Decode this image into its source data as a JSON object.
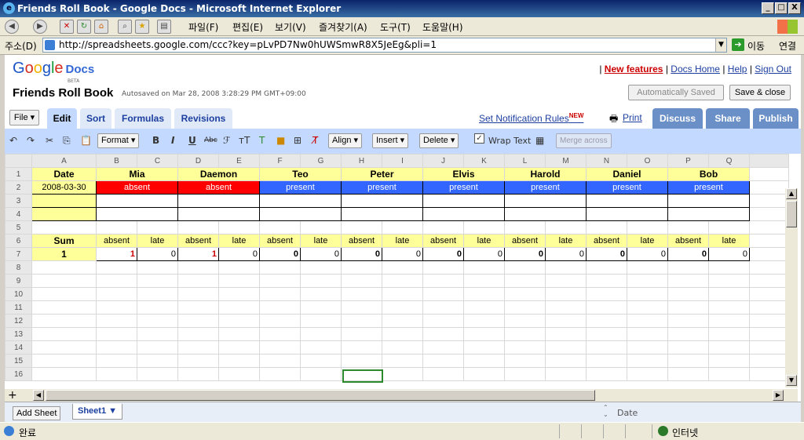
{
  "window": {
    "title": "Friends Roll Book - Google Docs - Microsoft Internet Explorer",
    "min": "_",
    "max": "□",
    "close": "X"
  },
  "menu": {
    "items": [
      "파일(F)",
      "편집(E)",
      "보기(V)",
      "즐겨찾기(A)",
      "도구(T)",
      "도움말(H)"
    ]
  },
  "address": {
    "label": "주소(D)",
    "url": "http://spreadsheets.google.com/ccc?key=pLvPD7Nw0hUWSmwR8X5JeEg&pli=1",
    "go": "이동",
    "links": "연결"
  },
  "header": {
    "logo_google": "Google",
    "logo_docs": "Docs",
    "beta": "BETA",
    "new_features": "New features",
    "docs_home": "Docs Home",
    "help": "Help",
    "sign_out": "Sign Out",
    "sep": "|",
    "title": "Friends Roll Book",
    "autosave": "Autosaved on Mar 28, 2008 3:28:29 PM GMT+09:00",
    "auto_saved_btn": "Automatically Saved",
    "save_close_btn": "Save & close"
  },
  "tabs": {
    "file": "File ▾",
    "edit": "Edit",
    "sort": "Sort",
    "formulas": "Formulas",
    "revisions": "Revisions",
    "notif": "Set Notification Rules",
    "notif_new": "NEW",
    "print": "Print",
    "discuss": "Discuss",
    "share": "Share",
    "publish": "Publish"
  },
  "toolbar": {
    "format": "Format ▾",
    "bold": "B",
    "italic": "I",
    "underline": "U",
    "strike": "Abc",
    "align": "Align ▾",
    "insert": "Insert ▾",
    "delete": "Delete ▾",
    "wrap": "Wrap Text",
    "merge": "Merge across"
  },
  "grid": {
    "cols": [
      "A",
      "B",
      "C",
      "D",
      "E",
      "F",
      "G",
      "H",
      "I",
      "J",
      "K",
      "L",
      "M",
      "N",
      "O",
      "P",
      "Q"
    ],
    "row1": [
      "Date",
      "Mia",
      "Daemon",
      "Teo",
      "Peter",
      "Elvis",
      "Harold",
      "Daniel",
      "Bob"
    ],
    "row2_date": "2008-03-30",
    "row2": [
      "absent",
      "absent",
      "present",
      "present",
      "present",
      "present",
      "present",
      "present"
    ],
    "row6": [
      "Sum",
      "absent",
      "late",
      "absent",
      "late",
      "absent",
      "late",
      "absent",
      "late",
      "absent",
      "late",
      "absent",
      "late",
      "absent",
      "late",
      "absent",
      "late"
    ],
    "row7": [
      "1",
      "1",
      "0",
      "1",
      "0",
      "0",
      "0",
      "0",
      "0",
      "0",
      "0",
      "0",
      "0",
      "0",
      "0",
      "0",
      "0"
    ],
    "rownums": [
      "1",
      "2",
      "3",
      "4",
      "5",
      "6",
      "7",
      "8",
      "9",
      "10",
      "11",
      "12",
      "13",
      "14",
      "15",
      "16"
    ]
  },
  "bottom": {
    "add_sheet": "Add Sheet",
    "sheet1": "Sheet1 ▼",
    "cell_ref": "Date"
  },
  "status": {
    "done": "완료",
    "zone": "인터넷"
  }
}
